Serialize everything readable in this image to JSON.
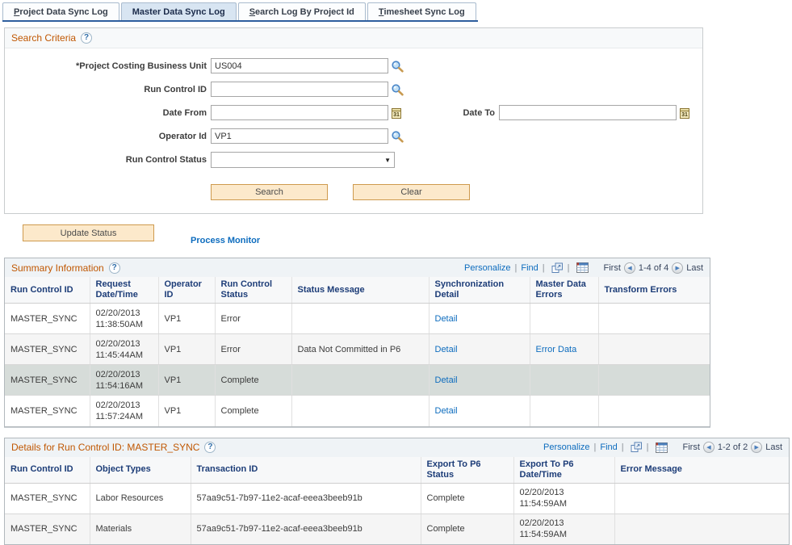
{
  "palette": {
    "accent_orange": "#C05702",
    "link_blue": "#0D6CBE",
    "header_navy": "#1D3D78",
    "tab_active_bg": "#D8E5F2",
    "tab_underline": "#2F5E9E",
    "button_bg": "#FCE9CB",
    "button_border": "#CE9A4E",
    "selected_row_bg": "#D6DCD9",
    "alt_row_bg": "#F5F5F5",
    "titlebar_bg": "#EFF3F6"
  },
  "tabs": [
    {
      "key": "P",
      "rest": "roject Data Sync Log"
    },
    {
      "key": "",
      "rest": "Master Data Sync Log"
    },
    {
      "key": "S",
      "rest": "earch Log By Project Id"
    },
    {
      "key": "T",
      "rest": "imesheet Sync Log"
    }
  ],
  "search": {
    "title": "Search Criteria",
    "fields": {
      "pc_bu": {
        "label": "*Project Costing Business Unit",
        "value": "US004"
      },
      "run_ctl": {
        "label": "Run Control ID",
        "value": ""
      },
      "date_from": {
        "label": "Date From",
        "value": ""
      },
      "date_to": {
        "label": "Date To",
        "value": ""
      },
      "operator": {
        "label": "Operator Id",
        "value": "VP1"
      },
      "run_status": {
        "label": "Run Control Status",
        "value": ""
      }
    },
    "buttons": {
      "search": "Search",
      "clear": "Clear"
    }
  },
  "actions": {
    "update_status": "Update Status",
    "process_monitor": "Process Monitor"
  },
  "summary": {
    "title": "Summary Information",
    "toolbar": {
      "personalize": "Personalize",
      "find": "Find",
      "first": "First",
      "range": "1-4 of 4",
      "last": "Last"
    },
    "columns": [
      "Run Control ID",
      "Request Date/Time",
      "Operator ID",
      "Run Control Status",
      "Status Message",
      "Synchronization Detail",
      "Master Data Errors",
      "Transform Errors"
    ],
    "rows": [
      {
        "id": "MASTER_SYNC",
        "date": "02/20/2013",
        "time": "11:38:50AM",
        "operator": "VP1",
        "status": "Error",
        "message": "",
        "sync_detail": "Detail",
        "master_errors": "",
        "transform_errors": ""
      },
      {
        "id": "MASTER_SYNC",
        "date": "02/20/2013",
        "time": "11:45:44AM",
        "operator": "VP1",
        "status": "Error",
        "message": "Data Not Committed in P6",
        "sync_detail": "Detail",
        "master_errors": "Error Data",
        "transform_errors": ""
      },
      {
        "id": "MASTER_SYNC",
        "date": "02/20/2013",
        "time": "11:54:16AM",
        "operator": "VP1",
        "status": "Complete",
        "message": "",
        "sync_detail": "Detail",
        "master_errors": "",
        "transform_errors": ""
      },
      {
        "id": "MASTER_SYNC",
        "date": "02/20/2013",
        "time": "11:57:24AM",
        "operator": "VP1",
        "status": "Complete",
        "message": "",
        "sync_detail": "Detail",
        "master_errors": "",
        "transform_errors": ""
      }
    ]
  },
  "details": {
    "title": "Details for Run Control ID: MASTER_SYNC",
    "toolbar": {
      "personalize": "Personalize",
      "find": "Find",
      "first": "First",
      "range": "1-2 of 2",
      "last": "Last"
    },
    "columns": [
      "Run Control ID",
      "Object Types",
      "Transaction ID",
      "Export To P6 Status",
      "Export To P6 Date/Time",
      "Error Message"
    ],
    "rows": [
      {
        "id": "MASTER_SYNC",
        "object_type": "Labor Resources",
        "transaction_id": "57aa9c51-7b97-11e2-acaf-eeea3beeb91b",
        "export_status": "Complete",
        "date": "02/20/2013",
        "time": "11:54:59AM",
        "error_message": ""
      },
      {
        "id": "MASTER_SYNC",
        "object_type": "Materials",
        "transaction_id": "57aa9c51-7b97-11e2-acaf-eeea3beeb91b",
        "export_status": "Complete",
        "date": "02/20/2013",
        "time": "11:54:59AM",
        "error_message": ""
      }
    ]
  }
}
